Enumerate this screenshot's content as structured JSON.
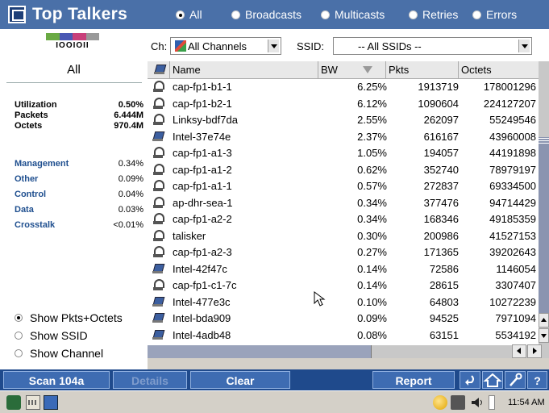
{
  "header": {
    "title": "Top Talkers",
    "filters": [
      {
        "label": "All",
        "selected": true
      },
      {
        "label": "Broadcasts",
        "selected": false
      },
      {
        "label": "Multicasts",
        "selected": false
      },
      {
        "label": "Retries",
        "selected": false
      },
      {
        "label": "Errors",
        "selected": false
      }
    ]
  },
  "left_panel": {
    "logo_text": "IOOIOII",
    "logo_colors": [
      "#6aaa44",
      "#4a58b4",
      "#c8407a",
      "#999999"
    ],
    "scope": "All",
    "stats": [
      {
        "label": "Utilization",
        "value": "0.50%"
      },
      {
        "label": "Packets",
        "value": "6.444M"
      },
      {
        "label": "Octets",
        "value": "970.4M"
      }
    ],
    "categories": [
      {
        "label": "Management",
        "value": "0.34%"
      },
      {
        "label": "Other",
        "value": "0.09%"
      },
      {
        "label": "Control",
        "value": "0.04%"
      },
      {
        "label": "Data",
        "value": "0.03%"
      },
      {
        "label": "Crosstalk",
        "value": "<0.01%"
      }
    ],
    "options": [
      {
        "label": "Show Pkts+Octets",
        "selected": true
      },
      {
        "label": "Show SSID",
        "selected": false
      },
      {
        "label": "Show Channel",
        "selected": false
      }
    ]
  },
  "filter_row": {
    "channel_label": "Ch:",
    "channel_value": "All Channels",
    "ssid_label": "SSID:",
    "ssid_value": "-- All SSIDs --"
  },
  "table": {
    "columns": [
      "Name",
      "BW",
      "Pkts",
      "Octets"
    ],
    "rows": [
      {
        "icon": "access-point",
        "name": "cap-fp1-b1-1",
        "bw": "6.25%",
        "pkts": "1913719",
        "octets": "178001296"
      },
      {
        "icon": "access-point",
        "name": "cap-fp1-b2-1",
        "bw": "6.12%",
        "pkts": "1090604",
        "octets": "224127207"
      },
      {
        "icon": "access-point",
        "name": "Linksy-bdf7da",
        "bw": "2.55%",
        "pkts": "262097",
        "octets": "55249546"
      },
      {
        "icon": "station",
        "name": "Intel-37e74e",
        "bw": "2.37%",
        "pkts": "616167",
        "octets": "43960008"
      },
      {
        "icon": "access-point",
        "name": "cap-fp1-a1-3",
        "bw": "1.05%",
        "pkts": "194057",
        "octets": "44191898"
      },
      {
        "icon": "access-point",
        "name": "cap-fp1-a1-2",
        "bw": "0.62%",
        "pkts": "352740",
        "octets": "78979197"
      },
      {
        "icon": "access-point",
        "name": "cap-fp1-a1-1",
        "bw": "0.57%",
        "pkts": "272837",
        "octets": "69334500"
      },
      {
        "icon": "access-point",
        "name": "ap-dhr-sea-1",
        "bw": "0.34%",
        "pkts": "377476",
        "octets": "94714429"
      },
      {
        "icon": "access-point",
        "name": "cap-fp1-a2-2",
        "bw": "0.34%",
        "pkts": "168346",
        "octets": "49185359"
      },
      {
        "icon": "access-point",
        "name": "talisker",
        "bw": "0.30%",
        "pkts": "200986",
        "octets": "41527153"
      },
      {
        "icon": "access-point",
        "name": "cap-fp1-a2-3",
        "bw": "0.27%",
        "pkts": "171365",
        "octets": "39202643"
      },
      {
        "icon": "station",
        "name": "Intel-42f47c",
        "bw": "0.14%",
        "pkts": "72586",
        "octets": "1146054"
      },
      {
        "icon": "access-point",
        "name": "cap-fp1-c1-7c",
        "bw": "0.14%",
        "pkts": "28615",
        "octets": "3307407"
      },
      {
        "icon": "station",
        "name": "Intel-477e3c",
        "bw": "0.10%",
        "pkts": "64803",
        "octets": "10272239"
      },
      {
        "icon": "station",
        "name": "Intel-bda909",
        "bw": "0.09%",
        "pkts": "94525",
        "octets": "7971094"
      },
      {
        "icon": "station",
        "name": "Intel-4adb48",
        "bw": "0.08%",
        "pkts": "63151",
        "octets": "5534192"
      }
    ]
  },
  "buttons": {
    "scan": "Scan 104a",
    "details": "Details",
    "clear": "Clear",
    "report": "Report",
    "help": "?"
  },
  "taskbar": {
    "time": "11:54 AM"
  }
}
